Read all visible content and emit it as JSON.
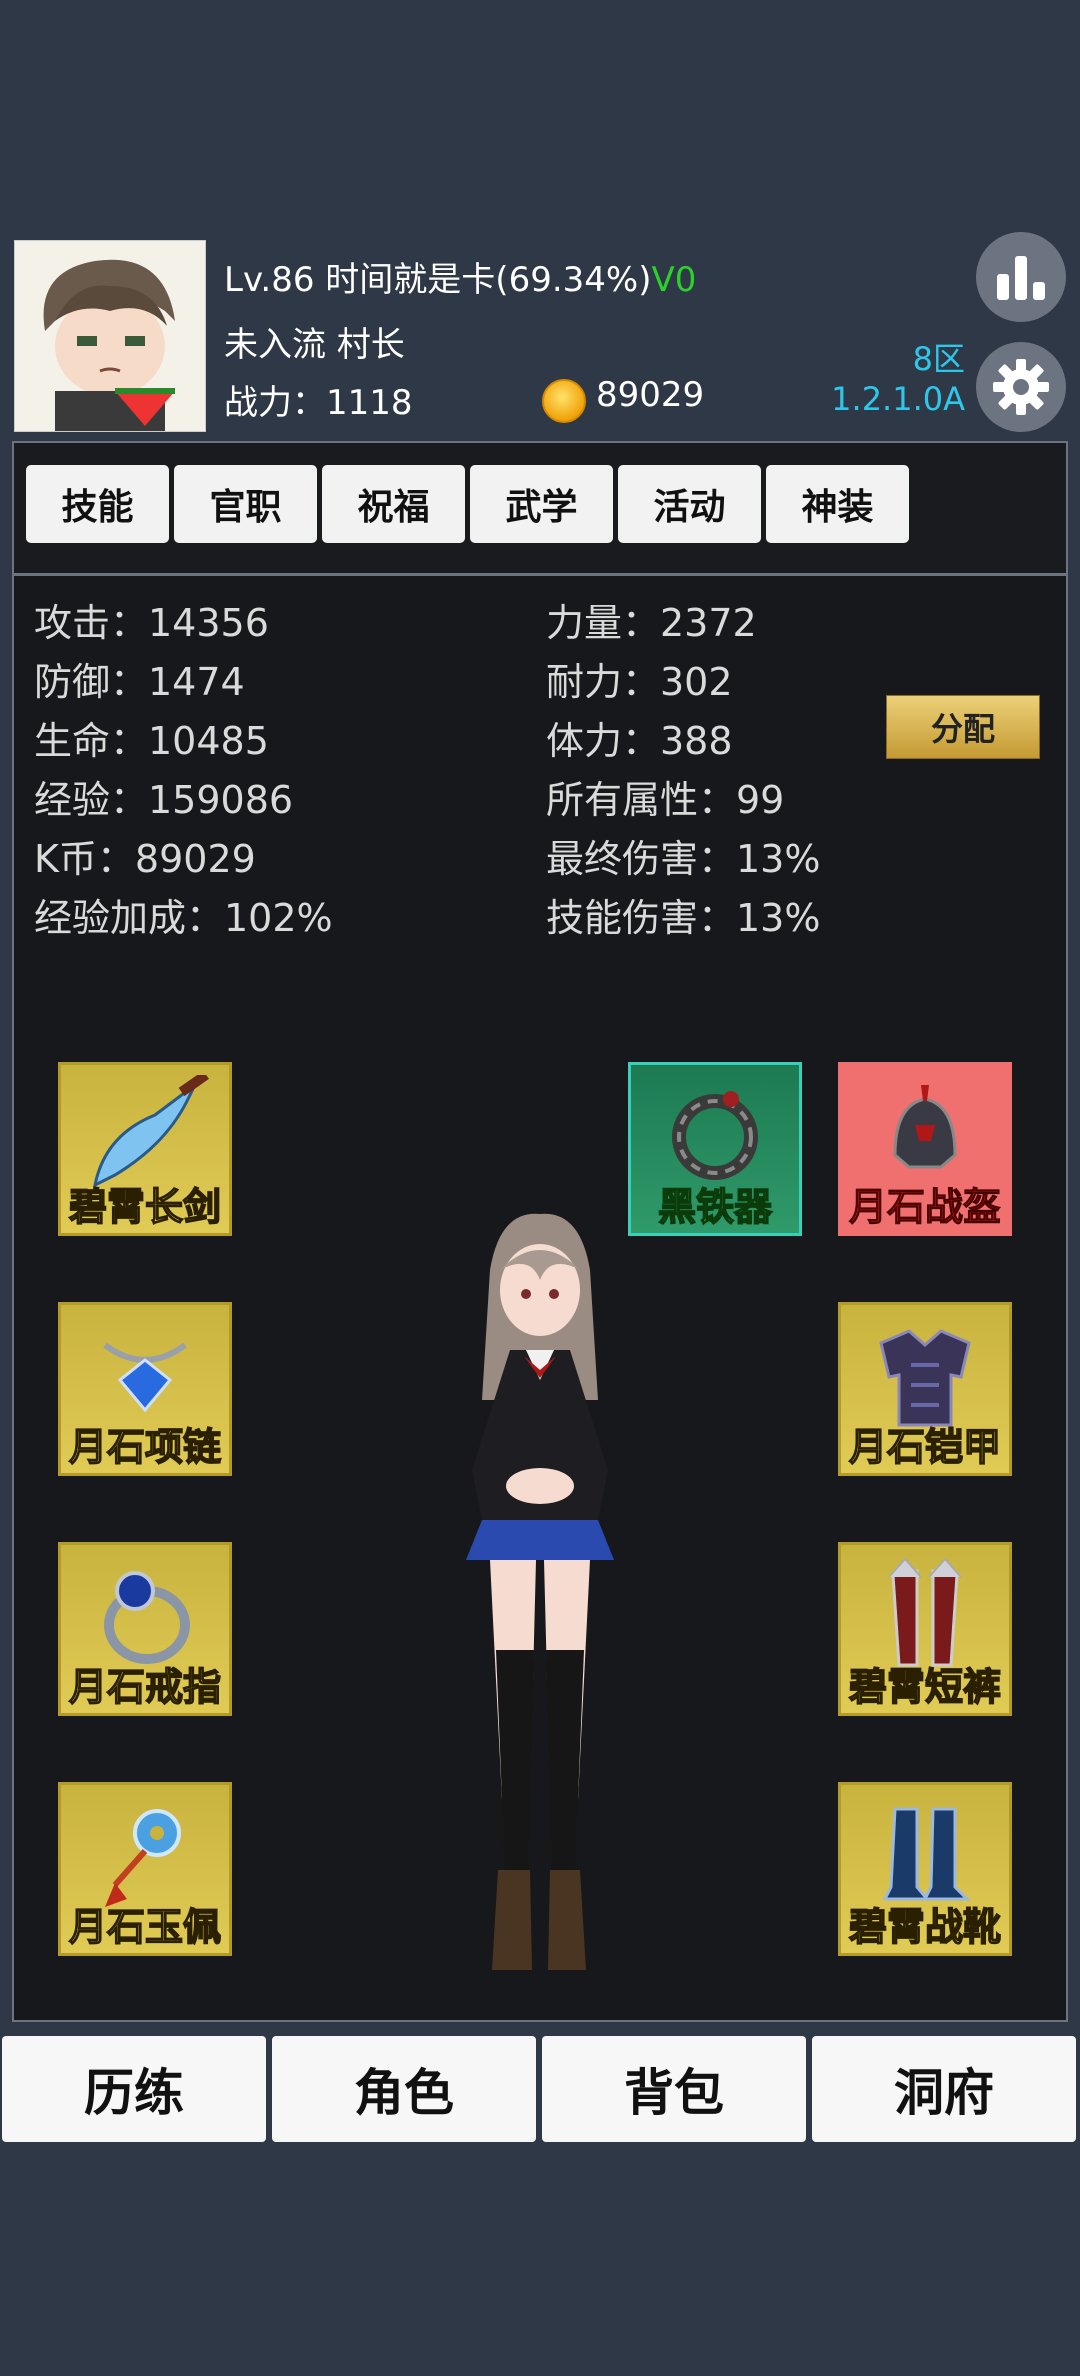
{
  "player": {
    "level_name": "Lv.86 时间就是卡(69.34%)",
    "vip": "V0",
    "rank": "未入流 村长",
    "power": "战力：1118",
    "coins": "89029"
  },
  "server": {
    "name": "8区",
    "version": "1.2.1.0A"
  },
  "tabs": [
    "技能",
    "官职",
    "祝福",
    "武学",
    "活动",
    "神装"
  ],
  "stats_left": [
    "攻击：14356",
    "防御：1474",
    "生命：10485",
    "经验：159086",
    "K币：89029",
    "经验加成：102%"
  ],
  "stats_right": [
    "力量：2372",
    "耐力：302",
    "体力：388",
    "所有属性：99",
    "最终伤害：13%",
    "技能伤害：13%"
  ],
  "distribute_label": "分配",
  "equipment": {
    "weapon": "碧霄长剑",
    "necklace": "月石项链",
    "ring": "月石戒指",
    "pendant": "月石玉佩",
    "accessory": "黑铁器",
    "helmet": "月石战盔",
    "armor": "月石铠甲",
    "pants": "碧霄短裤",
    "boots": "碧霄战靴"
  },
  "nav": [
    "历练",
    "角色",
    "背包",
    "洞府"
  ],
  "colors": {
    "accent_cyan": "#2ec7ec",
    "vip_green": "#2bd02b",
    "slot_gold": "#d8c24a",
    "slot_green": "#2f9a6a",
    "slot_red": "#f07070"
  },
  "icons": [
    "ranking-icon",
    "gear-icon",
    "coin-icon"
  ]
}
